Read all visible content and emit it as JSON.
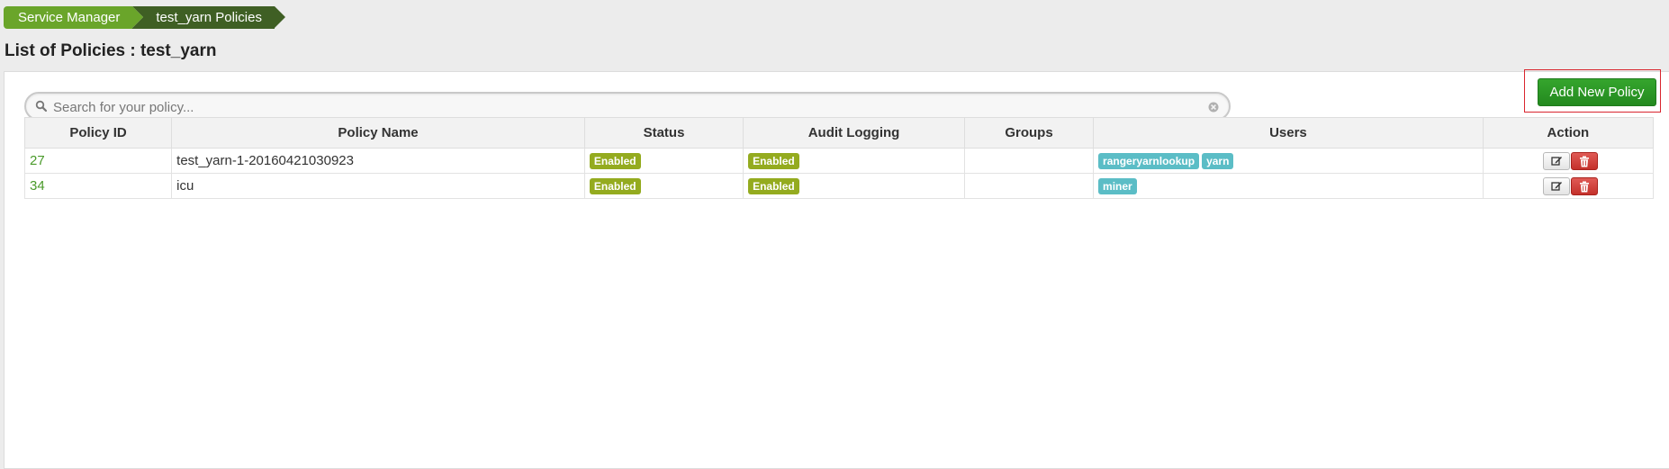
{
  "breadcrumb": {
    "items": [
      {
        "label": "Service Manager"
      },
      {
        "label": "test_yarn Policies"
      }
    ]
  },
  "page": {
    "title": "List of Policies : test_yarn"
  },
  "search": {
    "placeholder": "Search for your policy..."
  },
  "toolbar": {
    "add_label": "Add New Policy"
  },
  "table": {
    "columns": [
      "Policy ID",
      "Policy Name",
      "Status",
      "Audit Logging",
      "Groups",
      "Users",
      "Action"
    ],
    "rows": [
      {
        "id": "27",
        "name": "test_yarn-1-20160421030923",
        "status": "Enabled",
        "audit": "Enabled",
        "groups": "",
        "users": [
          "rangeryarnlookup",
          "yarn"
        ]
      },
      {
        "id": "34",
        "name": "icu",
        "status": "Enabled",
        "audit": "Enabled",
        "groups": "",
        "users": [
          "miner"
        ]
      }
    ]
  },
  "colors": {
    "breadcrumb_primary": "#6aa52a",
    "breadcrumb_active": "#3f5f24",
    "add_button": "#2a9a25",
    "status_label": "#94ab1f",
    "user_label": "#5bbdc6",
    "delete_button": "#d0403a",
    "highlight_border": "#d9252e"
  },
  "icons": {
    "search": "search-icon",
    "clear": "clear-icon",
    "edit": "edit-icon",
    "delete": "trash-icon"
  }
}
